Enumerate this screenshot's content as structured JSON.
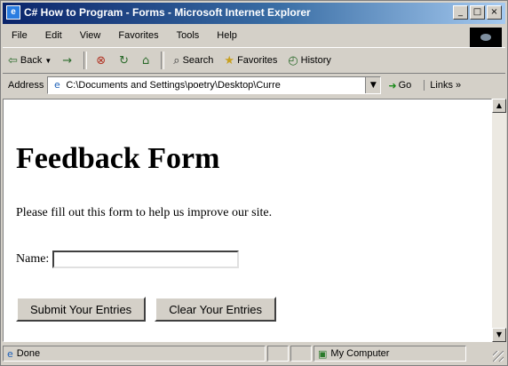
{
  "window": {
    "title": "C# How to Program - Forms - Microsoft Internet Explorer",
    "controls": {
      "minimize": "_",
      "maximize": "□",
      "close": "×"
    }
  },
  "menu": [
    "File",
    "Edit",
    "View",
    "Favorites",
    "Tools",
    "Help"
  ],
  "toolbar": {
    "back": "Back",
    "forward": "→",
    "search": "Search",
    "favorites": "Favorites",
    "history": "History",
    "icons": [
      "back-arrow-icon",
      "forward-arrow-icon",
      "stop-icon",
      "refresh-icon",
      "home-icon",
      "search-icon",
      "favorites-icon",
      "history-icon"
    ]
  },
  "address": {
    "label": "Address",
    "value": "C:\\Documents and Settings\\poetry\\Desktop\\Curre",
    "go": "Go",
    "links": "Links »"
  },
  "page": {
    "heading": "Feedback Form",
    "intro": "Please fill out this form to help us improve our site.",
    "name_label": "Name:",
    "name_value": "",
    "submit": "Submit Your Entries",
    "reset": "Clear Your Entries"
  },
  "status": {
    "text": "Done",
    "zone": "My Computer"
  },
  "colors": {
    "titlebar_start": "#0a246a",
    "titlebar_end": "#a6caf0",
    "chrome": "#d4d0c8"
  }
}
